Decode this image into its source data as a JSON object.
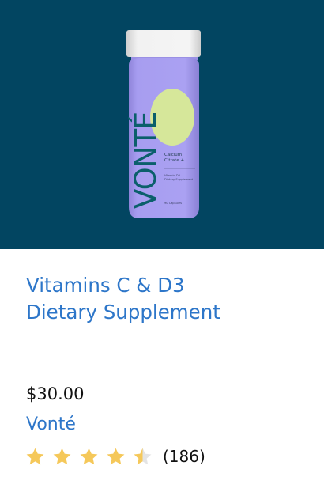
{
  "product": {
    "image": {
      "brand_text": "VONTÉ",
      "label_name_1": "Calcium",
      "label_name_2": "Citrate +",
      "label_sub_1": "Vitamin D3",
      "label_sub_2": "Dietary Supplement",
      "label_count": "90 Capsules"
    },
    "title_line1": "Vitamins C & D3",
    "title_line2": "Dietary Supplement",
    "price": "$30.00",
    "brand": "Vonté",
    "rating": {
      "value": 4.5,
      "max": 5,
      "count_text": "(186)"
    }
  },
  "colors": {
    "hero_background": "#024561",
    "bottle": "#a79df0",
    "cap": "#ebebeb",
    "label_blob": "#d6e79a",
    "brand_text": "#0b5f6b",
    "link": "#2d76c9",
    "star_filled": "#f5c85a",
    "star_empty": "#e4e4e4"
  }
}
